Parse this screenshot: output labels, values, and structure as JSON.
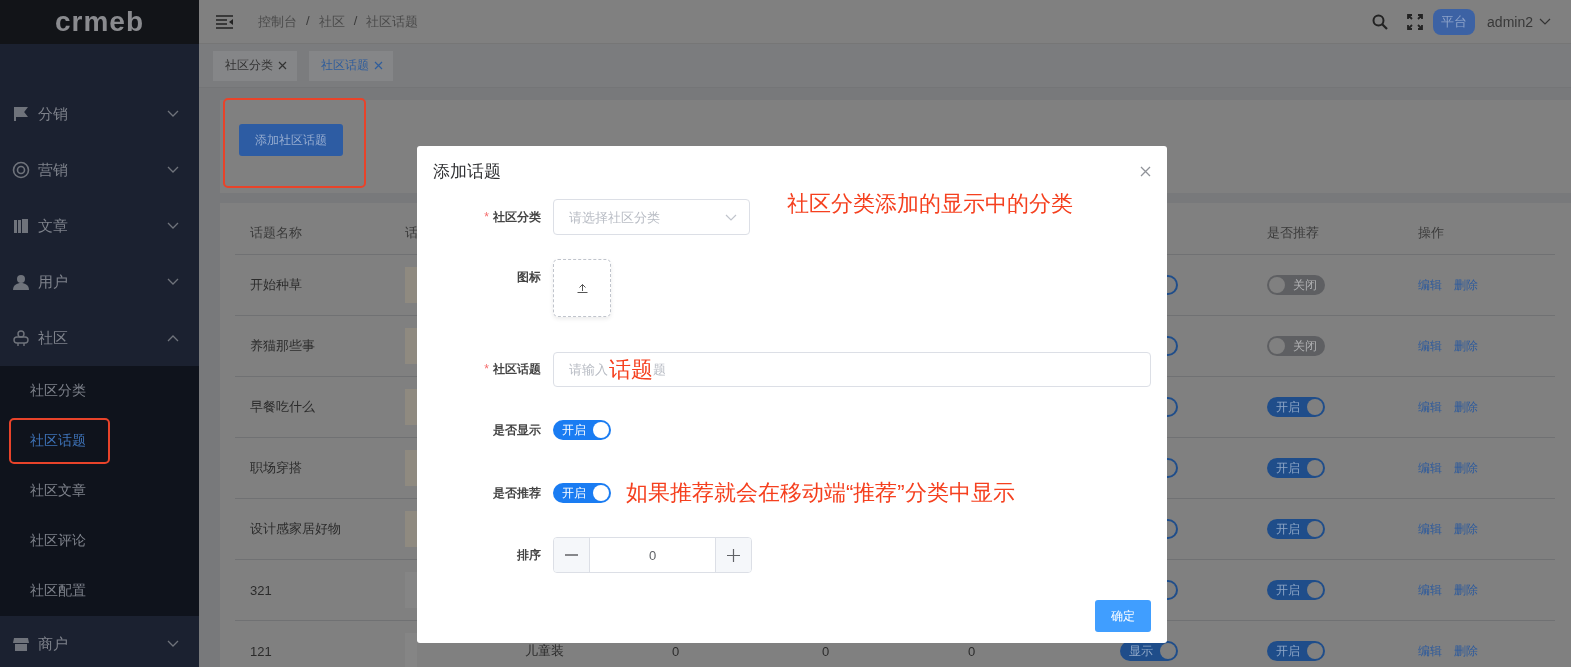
{
  "sidebar": {
    "logo": "crmeb",
    "menu": [
      {
        "label": "分销",
        "expanded": false
      },
      {
        "label": "营销",
        "expanded": false
      },
      {
        "label": "文章",
        "expanded": false
      },
      {
        "label": "用户",
        "expanded": false
      },
      {
        "label": "社区",
        "expanded": true,
        "children": [
          {
            "label": "社区分类",
            "selected": false,
            "highlighted": false
          },
          {
            "label": "社区话题",
            "selected": true,
            "highlighted": true
          },
          {
            "label": "社区文章",
            "selected": false,
            "highlighted": false
          },
          {
            "label": "社区评论",
            "selected": false,
            "highlighted": false
          },
          {
            "label": "社区配置",
            "selected": false,
            "highlighted": false
          }
        ]
      },
      {
        "label": "商户",
        "expanded": false
      }
    ]
  },
  "header": {
    "breadcrumb": [
      {
        "label": "控制台"
      },
      {
        "separator": "/",
        "label": "社区"
      },
      {
        "separator": "/",
        "label": "社区话题"
      }
    ],
    "badge": "平台",
    "user": "admin2"
  },
  "tabs": [
    {
      "label": "社区分类",
      "selected": false
    },
    {
      "label": "社区话题",
      "selected": true
    }
  ],
  "add_button": {
    "label": "添加社区话题",
    "highlighted": true
  },
  "table": {
    "columns": [
      "话题名称",
      "话",
      "是否推荐",
      "操作"
    ],
    "rows": [
      {
        "name": "开始种草",
        "shown": true,
        "recommend": false,
        "recommend_label": "关闭",
        "actions": [
          "编辑",
          "删除"
        ]
      },
      {
        "name": "养猫那些事",
        "shown": true,
        "recommend": false,
        "recommend_label": "关闭",
        "actions": [
          "编辑",
          "删除"
        ]
      },
      {
        "name": "早餐吃什么",
        "shown": true,
        "recommend": true,
        "recommend_label": "开启",
        "actions": [
          "编辑",
          "删除"
        ]
      },
      {
        "name": "职场穿搭",
        "shown": true,
        "recommend": true,
        "recommend_label": "开启",
        "actions": [
          "编辑",
          "删除"
        ]
      },
      {
        "name": "设计感家居好物",
        "shown": true,
        "recommend": true,
        "recommend_label": "开启",
        "actions": [
          "编辑",
          "删除"
        ]
      },
      {
        "name": "321",
        "shown": true,
        "recommend": true,
        "recommend_label": "开启",
        "actions": [
          "编辑",
          "删除"
        ]
      },
      {
        "name": "121",
        "category": "儿童装",
        "column_4": "0",
        "column_5": "0",
        "column_6": "0",
        "shown": true,
        "shown_label": "显示",
        "recommend": true,
        "recommend_label": "开启",
        "actions": [
          "编辑",
          "删除"
        ]
      }
    ]
  },
  "dialog": {
    "title": "添加话题",
    "fields": [
      {
        "kind": "select",
        "label": "社区分类",
        "required_mark": "*",
        "placeholder": "请选择社区分类",
        "note": "社区分类添加的显示中的分类"
      },
      {
        "kind": "upload",
        "label": "图标"
      },
      {
        "kind": "text",
        "label": "社区话题",
        "required_mark": "*",
        "placeholder": "请输入",
        "note": "话题",
        "placeholder_tail": "题"
      },
      {
        "kind": "switch",
        "label": "是否显示",
        "on": true,
        "switch_label": "开启"
      },
      {
        "kind": "switch",
        "label": "是否推荐",
        "on": true,
        "switch_label": "开启",
        "note": "如果推荐就会在移动端“推荐”分类中显示"
      },
      {
        "kind": "number",
        "label": "排序",
        "value": "0"
      }
    ],
    "confirm": "确定"
  }
}
